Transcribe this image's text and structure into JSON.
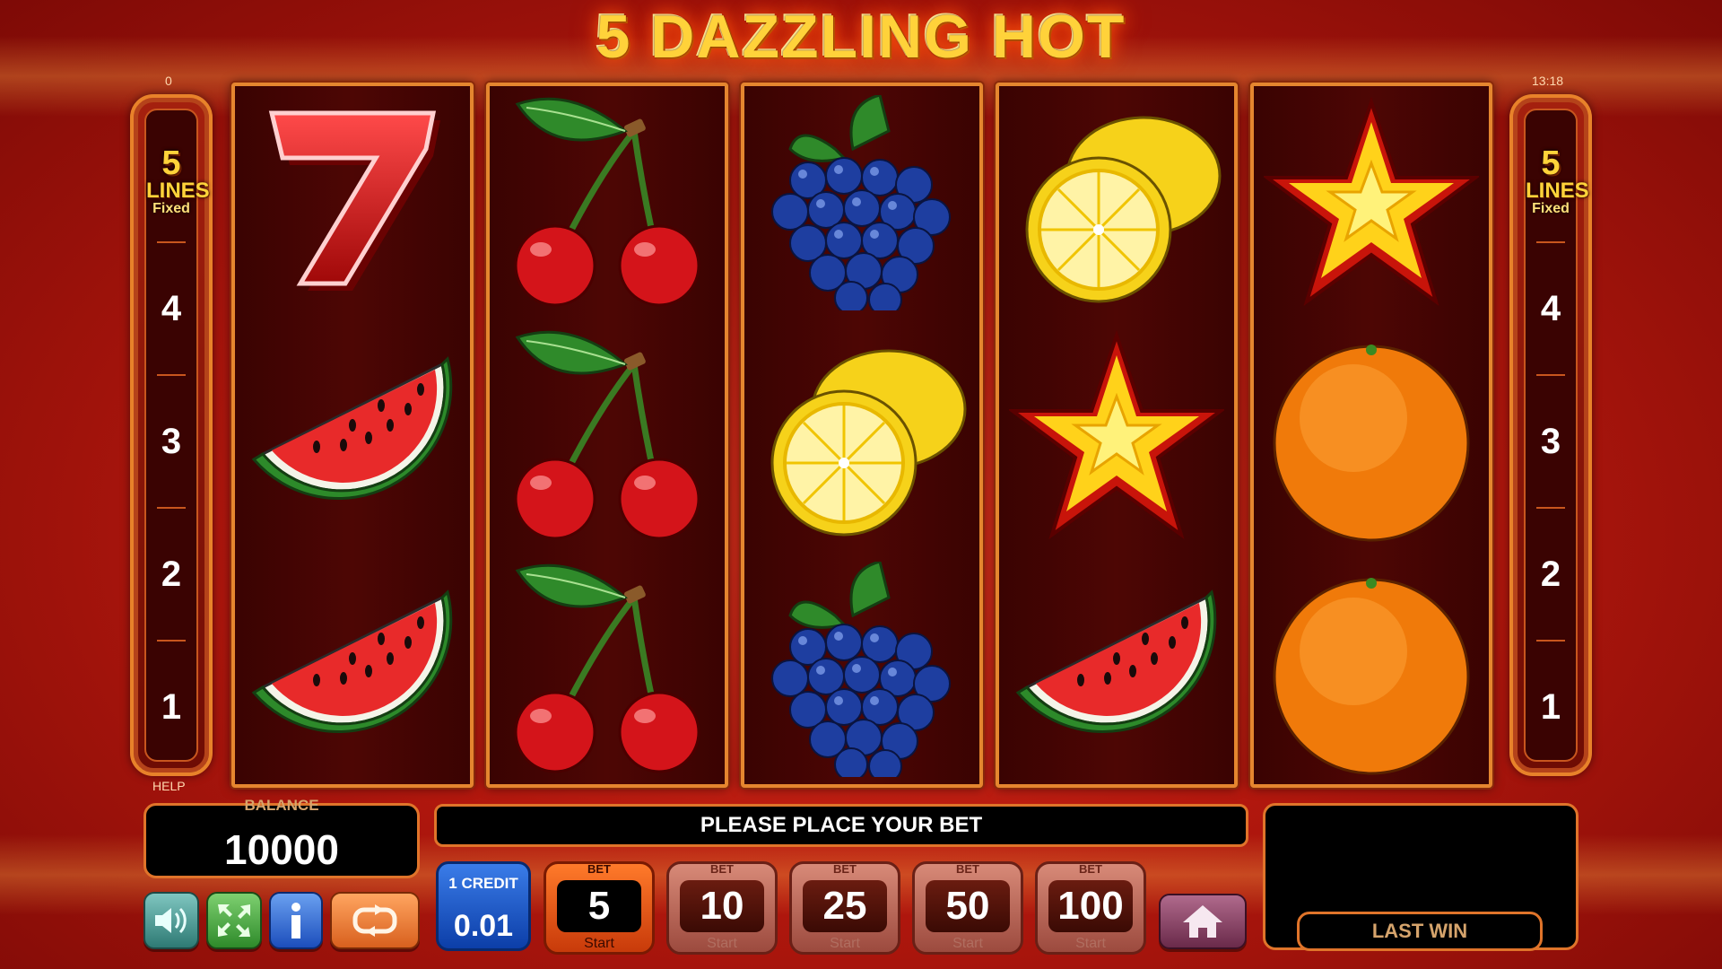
{
  "title": "5 DAZZLING HOT",
  "top_left_counter": "0",
  "clock": "13:18",
  "help_label": "HELP",
  "line_indicator": {
    "count": "5",
    "word": "LINES",
    "mode": "Fixed",
    "numbers": [
      "4",
      "3",
      "2",
      "1"
    ]
  },
  "reels": [
    [
      "seven",
      "watermelon",
      "watermelon"
    ],
    [
      "cherries",
      "cherries",
      "cherries"
    ],
    [
      "grapes",
      "lemon",
      "grapes"
    ],
    [
      "lemon",
      "star",
      "watermelon"
    ],
    [
      "star",
      "orange",
      "orange"
    ]
  ],
  "balance": {
    "label": "BALANCE",
    "value": "10000"
  },
  "message": "PLEASE PLACE YOUR BET",
  "credit": {
    "label": "1 CREDIT",
    "value": "0.01"
  },
  "bets": [
    {
      "caption": "BET",
      "value": "5",
      "start": "Start",
      "active": true
    },
    {
      "caption": "BET",
      "value": "10",
      "start": "Start",
      "active": false
    },
    {
      "caption": "BET",
      "value": "25",
      "start": "Start",
      "active": false
    },
    {
      "caption": "BET",
      "value": "50",
      "start": "Start",
      "active": false
    },
    {
      "caption": "BET",
      "value": "100",
      "start": "Start",
      "active": false
    }
  ],
  "last_win_label": "LAST WIN",
  "icons": {
    "sound": "speaker-icon",
    "fullscreen": "fullscreen-icon",
    "info": "info-icon",
    "autoplay": "autoplay-icon",
    "home": "home-icon"
  },
  "colors": {
    "background": "#b4180e",
    "reel_border": "#e5862f",
    "title": "#ffd23a",
    "active_bet": "#ff7a2a",
    "credit": "#3a7ce8"
  }
}
